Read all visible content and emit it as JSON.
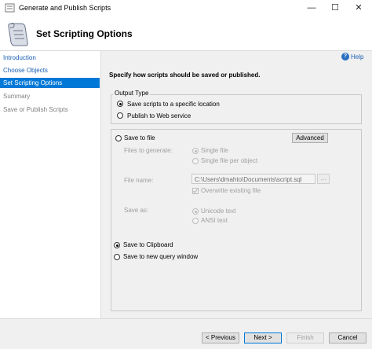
{
  "window": {
    "title": "Generate and Publish Scripts",
    "minimize_glyph": "—",
    "maximize_glyph": "☐",
    "close_glyph": "✕"
  },
  "header": {
    "title": "Set Scripting Options"
  },
  "sidebar": {
    "items": [
      {
        "label": "Introduction",
        "state": "link"
      },
      {
        "label": "Choose Objects",
        "state": "link"
      },
      {
        "label": "Set Scripting Options",
        "state": "active"
      },
      {
        "label": "Summary",
        "state": "disabled"
      },
      {
        "label": "Save or Publish Scripts",
        "state": "disabled"
      }
    ]
  },
  "help": {
    "label": "Help",
    "icon": "?"
  },
  "main": {
    "instruction": "Specify how scripts should be saved or published.",
    "output_type": {
      "legend": "Output Type",
      "options": [
        {
          "label": "Save scripts to a specific location",
          "checked": true
        },
        {
          "label": "Publish to Web service",
          "checked": false
        }
      ]
    },
    "save_options": {
      "save_to_file": "Save to file",
      "advanced": "Advanced",
      "files_to_generate_label": "Files to generate:",
      "single_file": "Single file",
      "single_file_per_object": "Single file per object",
      "file_name_label": "File name:",
      "file_name_value": "C:\\Users\\dmahto\\Documents\\script.sql",
      "browse_label": "...",
      "overwrite": "Overwrite existing file",
      "save_as_label": "Save as:",
      "unicode_text": "Unicode text",
      "ansi_text": "ANSI text",
      "save_to_clipboard": "Save to Clipboard",
      "save_to_new_query": "Save to new query window"
    }
  },
  "footer": {
    "previous": "< Previous",
    "next": "Next >",
    "finish": "Finish",
    "cancel": "Cancel"
  }
}
